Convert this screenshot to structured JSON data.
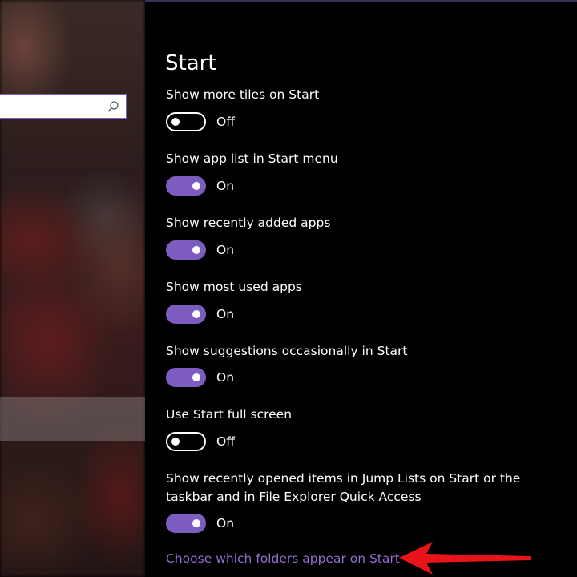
{
  "page": {
    "title": "Start"
  },
  "search": {
    "placeholder": "",
    "icon": "search-icon"
  },
  "settings": [
    {
      "label": "Show more tiles on Start",
      "state": "Off"
    },
    {
      "label": "Show app list in Start menu",
      "state": "On"
    },
    {
      "label": "Show recently added apps",
      "state": "On"
    },
    {
      "label": "Show most used apps",
      "state": "On"
    },
    {
      "label": "Show suggestions occasionally in Start",
      "state": "On"
    },
    {
      "label": "Use Start full screen",
      "state": "Off"
    },
    {
      "label": "Show recently opened items in Jump Lists on Start or the taskbar and in File Explorer Quick Access",
      "state": "On"
    }
  ],
  "link": {
    "label": "Choose which folders appear on Start"
  },
  "colors": {
    "accent": "#7d5cc0",
    "link": "#8f6fd0",
    "annotation_arrow": "#e8141b"
  }
}
